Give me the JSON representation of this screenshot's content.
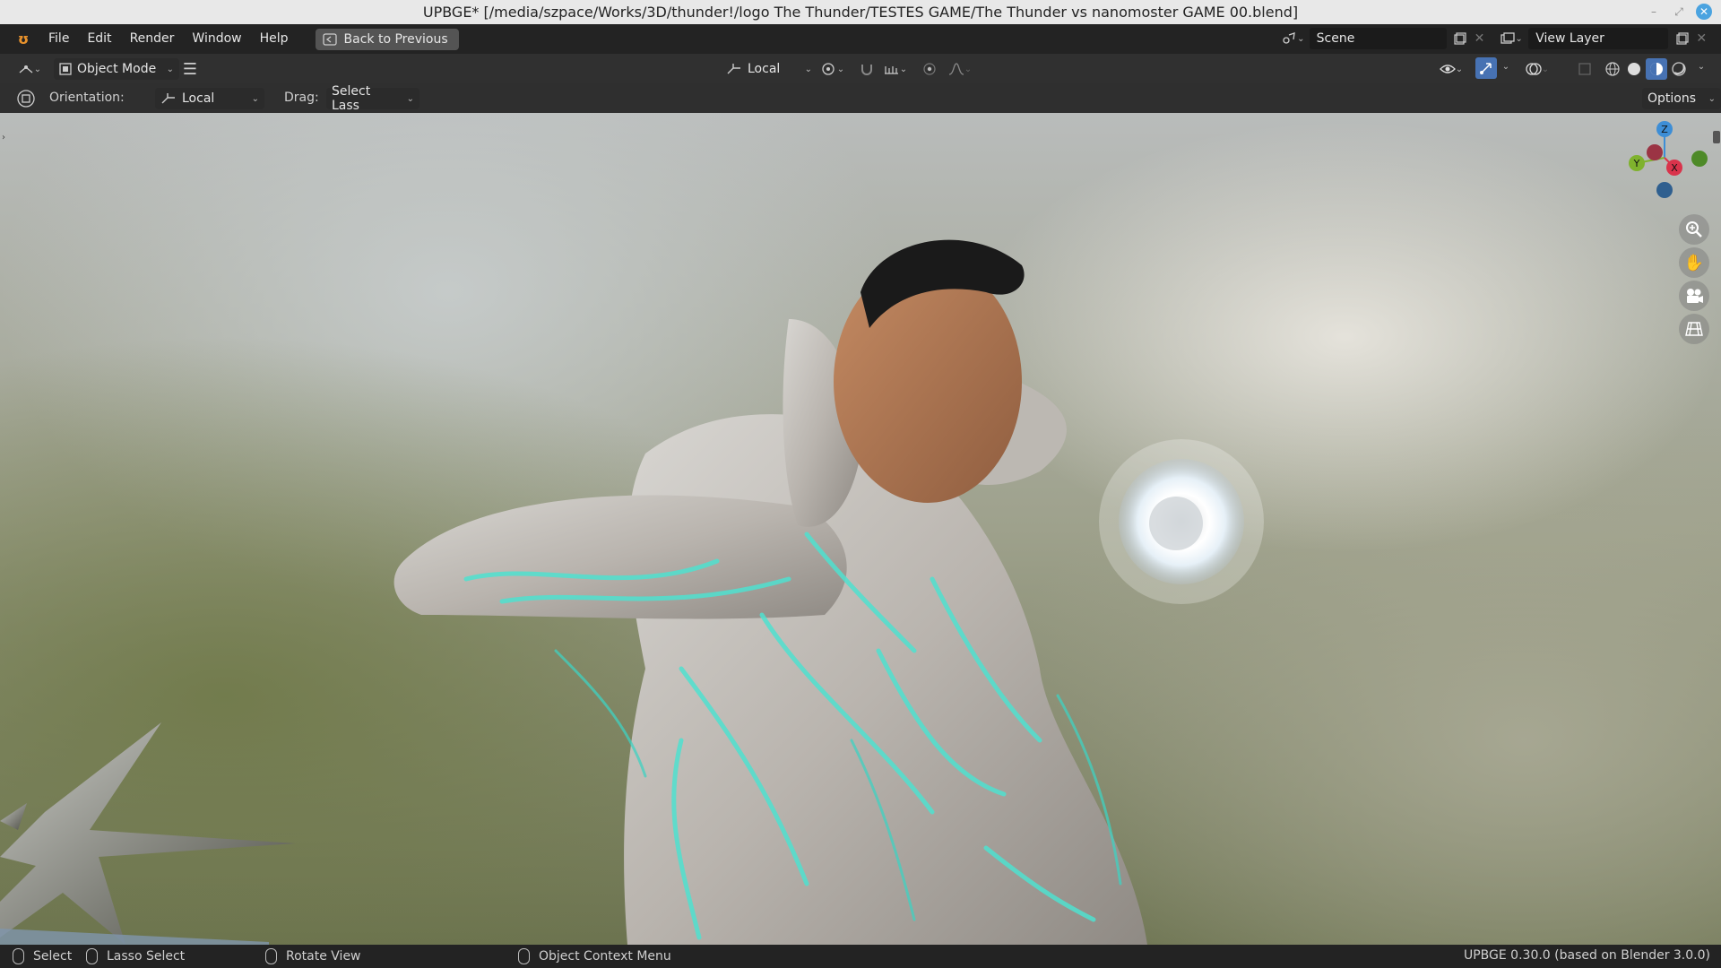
{
  "window": {
    "title": "UPBGE* [/media/szpace/Works/3D/thunder!/logo The Thunder/TESTES GAME/The Thunder vs nanomoster GAME 00.blend]"
  },
  "menubar": {
    "items": [
      "File",
      "Edit",
      "Render",
      "Window",
      "Help"
    ],
    "back_button": "Back to Previous",
    "scene_label": "Scene",
    "view_layer_label": "View Layer"
  },
  "header": {
    "mode": "Object Mode",
    "transform_orientation": "Local"
  },
  "tool_settings": {
    "orientation_label": "Orientation:",
    "orientation_value": "Local",
    "drag_label": "Drag:",
    "drag_value": "Select Lass",
    "options_label": "Options"
  },
  "gizmo": {
    "axes": [
      "Z",
      "Y",
      "X"
    ],
    "colors": {
      "x": "#d9334b",
      "y": "#7fb22d",
      "z": "#3d8ed6"
    }
  },
  "nav_icons": [
    "zoom-icon",
    "pan-hand-icon",
    "camera-icon",
    "ortho-grid-icon"
  ],
  "statusbar": {
    "select": "Select",
    "lasso_select": "Lasso Select",
    "rotate_view": "Rotate View",
    "context_menu": "Object Context Menu",
    "version": "UPBGE 0.30.0 (based on Blender 3.0.0)"
  }
}
